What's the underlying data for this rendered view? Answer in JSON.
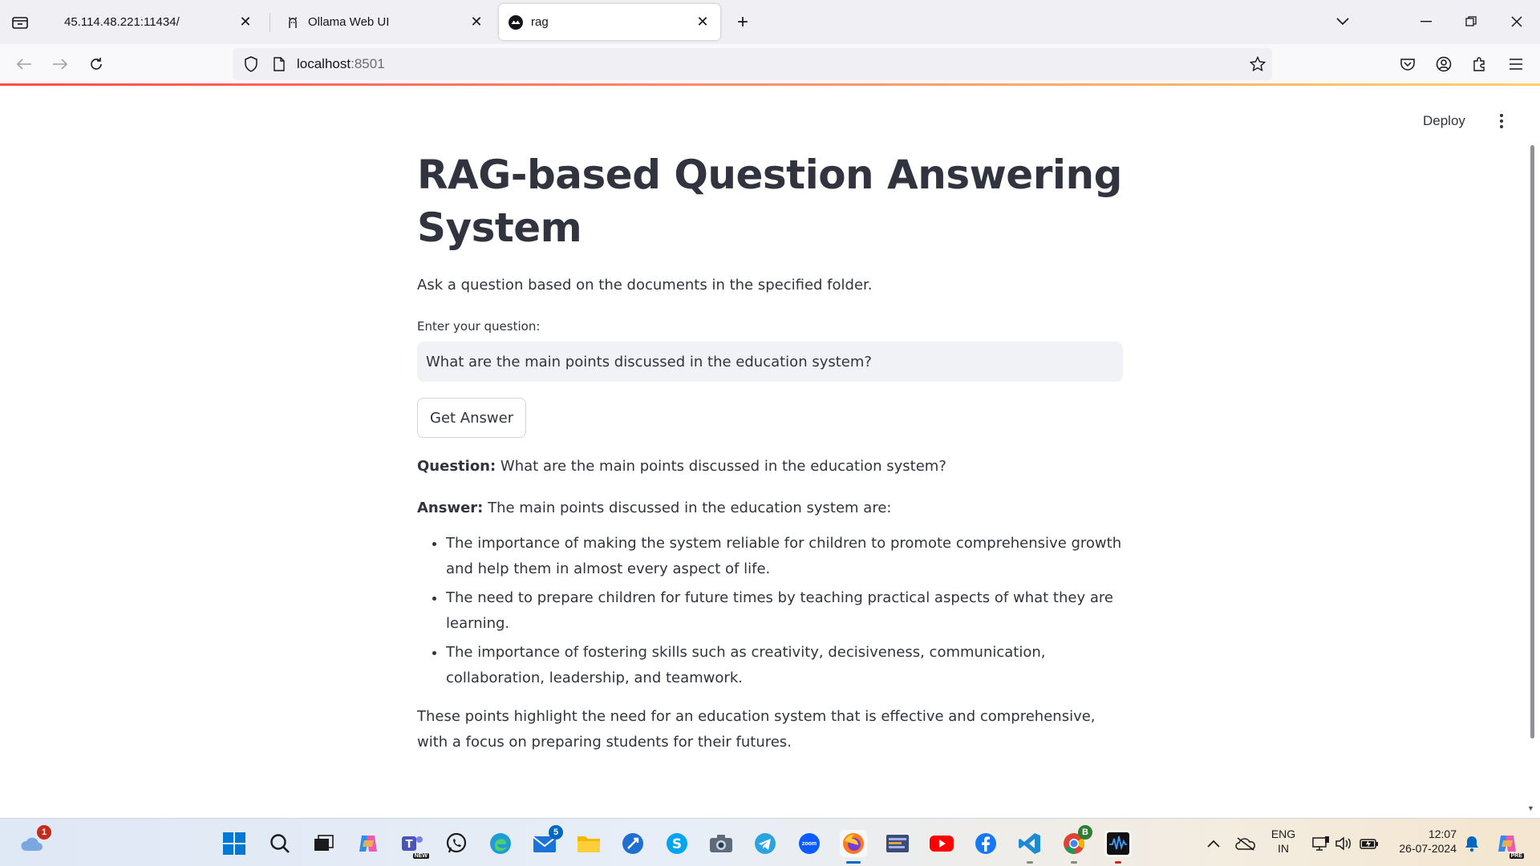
{
  "browser": {
    "tabs": [
      {
        "title": "45.114.48.221:11434/",
        "active": false
      },
      {
        "title": "Ollama Web UI",
        "active": false
      },
      {
        "title": "rag",
        "active": true
      }
    ],
    "url": {
      "host": "localhost",
      "port": ":8501"
    }
  },
  "app": {
    "deploy_label": "Deploy",
    "title": "RAG-based Question Answering System",
    "subtitle": "Ask a question based on the documents in the specified folder.",
    "question_label": "Enter your question:",
    "question_value": "What are the main points discussed in the education system?",
    "button_label": "Get Answer",
    "result": {
      "question_prefix": "Question:",
      "question_text": " What are the main points discussed in the education system?",
      "answer_prefix": "Answer:",
      "answer_intro": " The main points discussed in the education system are:",
      "points": [
        "The importance of making the system reliable for children to promote comprehensive growth and help them in almost every aspect of life.",
        "The need to prepare children for future times by teaching practical aspects of what they are learning.",
        "The importance of fostering skills such as creativity, decisiveness, communication, collaboration, leadership, and teamwork."
      ],
      "summary": "These points highlight the need for an education system that is effective and comprehensive, with a focus on preparing students for their futures."
    }
  },
  "taskbar": {
    "weather_badge": "1",
    "mail_badge": "5",
    "chrome_badge": "B",
    "teams_tag": "NEW",
    "copilot_tag": "PRE",
    "zoom_text": "zoom",
    "lang_line1": "ENG",
    "lang_line2": "IN",
    "time": "12:07",
    "date": "26-07-2024"
  },
  "colors": {
    "accent": "#ff4b4b",
    "text": "#31333f",
    "input_bg": "#f0f2f6"
  }
}
